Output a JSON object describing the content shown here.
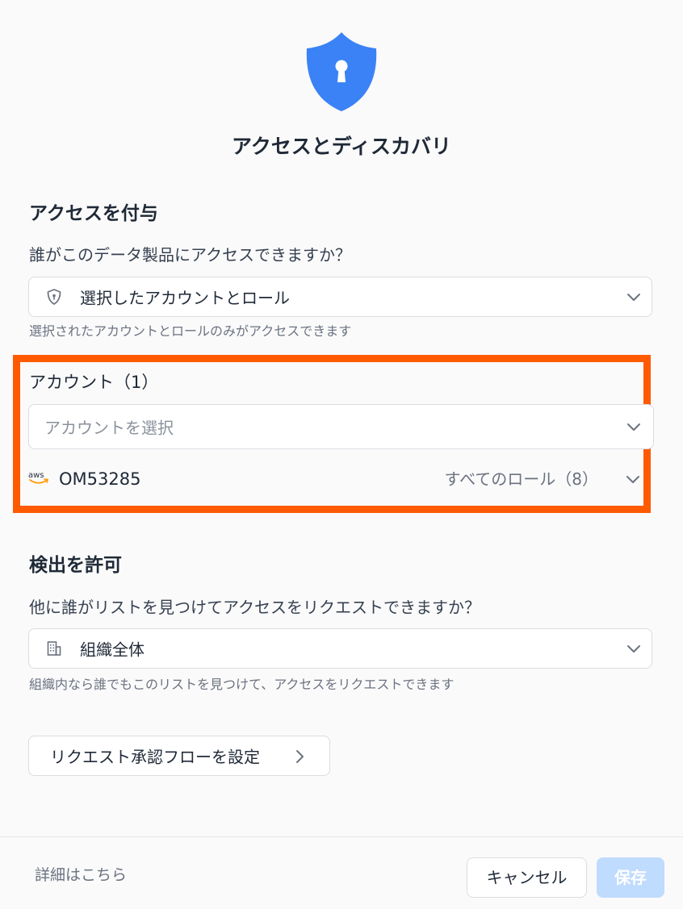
{
  "dialog": {
    "title": "アクセスとディスカバリ",
    "icon": "shield-lock-icon",
    "accent_color": "#3b82f6"
  },
  "access": {
    "heading": "アクセスを付与",
    "question": "誰がこのデータ製品にアクセスできますか？",
    "select_value": "選択したアカウントとロール",
    "select_icon": "shield-icon",
    "helper": "選択されたアカウントとロールのみがアクセスできます",
    "accounts": {
      "label": "アカウント（1）",
      "placeholder": "アカウントを選択",
      "items": [
        {
          "provider_icon": "aws-logo-icon",
          "provider_text": "aws",
          "account_id": "OM53285",
          "roles": "すべてのロール（8）"
        }
      ]
    },
    "highlight_color": "#ff5a00"
  },
  "discovery": {
    "heading": "検出を許可",
    "question": "他に誰がリストを見つけてアクセスをリクエストできますか？",
    "select_value": "組織全体",
    "select_icon": "building-icon",
    "helper": "組織内なら誰でもこのリストを見つけて、アクセスをリクエストできます"
  },
  "flow_button": {
    "label": "リクエスト承認フローを設定"
  },
  "footer": {
    "learn_more": "詳細はこちら",
    "cancel": "キャンセル",
    "save": "保存",
    "save_color": "#bfdbfe"
  }
}
